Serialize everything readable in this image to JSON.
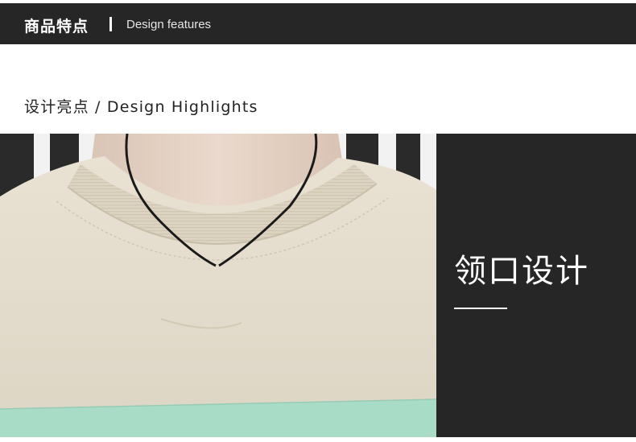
{
  "header": {
    "title_cn": "商品特点",
    "title_en": "Design features"
  },
  "section": {
    "subtitle": "设计亮点 / Design Highlights"
  },
  "panel": {
    "title": "领口设计"
  },
  "colors": {
    "dark": "#262626",
    "shirt": "#e4dccc",
    "stripe": "#a9dcc6"
  }
}
